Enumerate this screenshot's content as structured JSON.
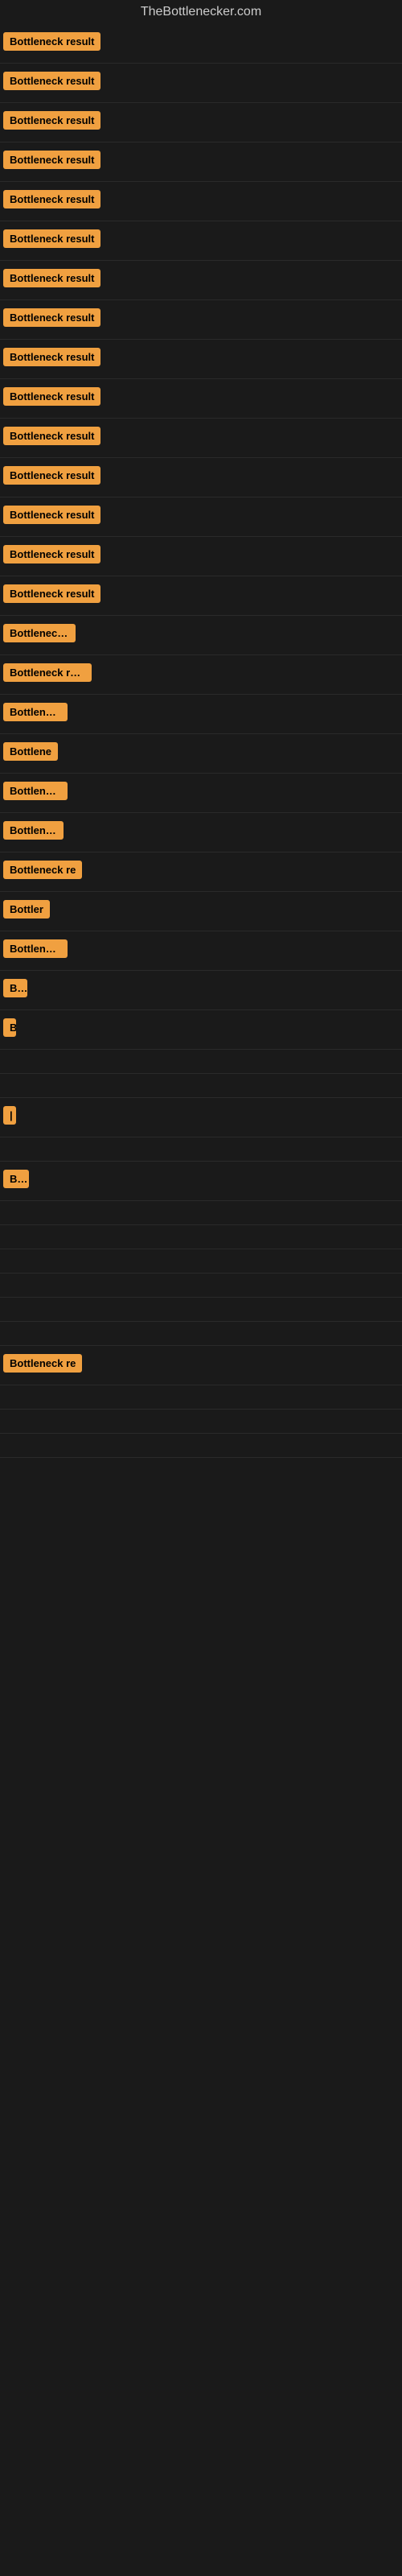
{
  "site": {
    "title": "TheBottlenecker.com"
  },
  "rows": [
    {
      "label": "Bottleneck result",
      "width": 140
    },
    {
      "label": "Bottleneck result",
      "width": 140
    },
    {
      "label": "Bottleneck result",
      "width": 140
    },
    {
      "label": "Bottleneck result",
      "width": 140
    },
    {
      "label": "Bottleneck result",
      "width": 140
    },
    {
      "label": "Bottleneck result",
      "width": 140
    },
    {
      "label": "Bottleneck result",
      "width": 140
    },
    {
      "label": "Bottleneck result",
      "width": 140
    },
    {
      "label": "Bottleneck result",
      "width": 140
    },
    {
      "label": "Bottleneck result",
      "width": 140
    },
    {
      "label": "Bottleneck result",
      "width": 140
    },
    {
      "label": "Bottleneck result",
      "width": 140
    },
    {
      "label": "Bottleneck result",
      "width": 140
    },
    {
      "label": "Bottleneck result",
      "width": 140
    },
    {
      "label": "Bottleneck result",
      "width": 135
    },
    {
      "label": "Bottleneck r",
      "width": 90
    },
    {
      "label": "Bottleneck resu",
      "width": 110
    },
    {
      "label": "Bottleneck",
      "width": 80
    },
    {
      "label": "Bottlene",
      "width": 68
    },
    {
      "label": "Bottleneck",
      "width": 80
    },
    {
      "label": "Bottlenec",
      "width": 75
    },
    {
      "label": "Bottleneck re",
      "width": 100
    },
    {
      "label": "Bottler",
      "width": 58
    },
    {
      "label": "Bottleneck",
      "width": 80
    },
    {
      "label": "Bo",
      "width": 30
    },
    {
      "label": "B",
      "width": 16
    },
    {
      "label": "",
      "width": 0
    },
    {
      "label": "",
      "width": 0
    },
    {
      "label": "|",
      "width": 8
    },
    {
      "label": "",
      "width": 0
    },
    {
      "label": "Bot",
      "width": 32
    },
    {
      "label": "",
      "width": 0
    },
    {
      "label": "",
      "width": 0
    },
    {
      "label": "",
      "width": 0
    },
    {
      "label": "",
      "width": 0
    },
    {
      "label": "",
      "width": 0
    },
    {
      "label": "",
      "width": 0
    },
    {
      "label": "Bottleneck re",
      "width": 100
    },
    {
      "label": "",
      "width": 0
    },
    {
      "label": "",
      "width": 0
    },
    {
      "label": "",
      "width": 0
    }
  ]
}
